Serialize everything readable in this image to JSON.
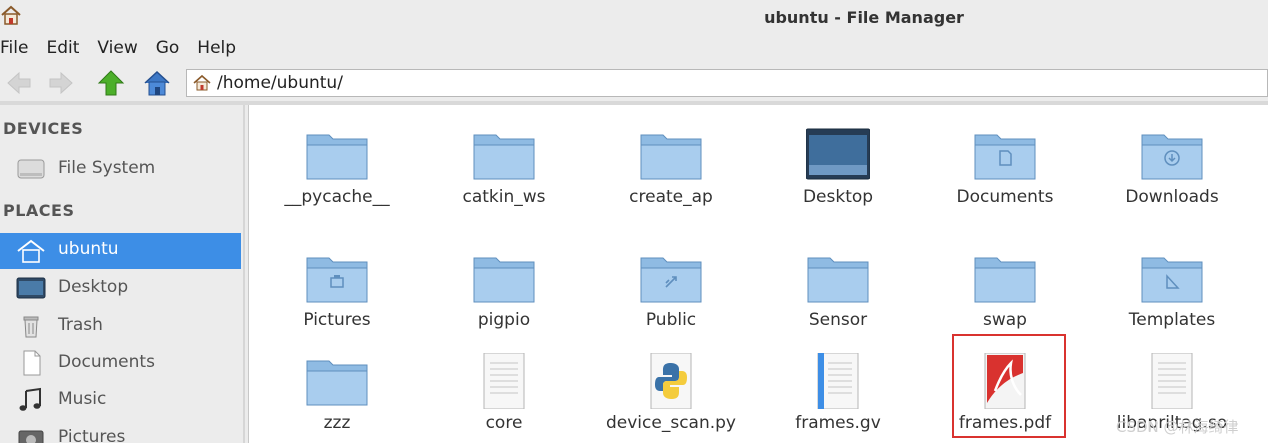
{
  "window": {
    "title": "ubuntu - File Manager"
  },
  "menu": [
    "File",
    "Edit",
    "View",
    "Go",
    "Help"
  ],
  "address": {
    "path": "/home/ubuntu/"
  },
  "sidebar": {
    "devices_header": "DEVICES",
    "devices": [
      {
        "label": "File System",
        "icon": "drive-icon"
      }
    ],
    "places_header": "PLACES",
    "places": [
      {
        "label": "ubuntu",
        "icon": "home-icon",
        "active": true
      },
      {
        "label": "Desktop",
        "icon": "desktop-icon"
      },
      {
        "label": "Trash",
        "icon": "trash-icon"
      },
      {
        "label": "Documents",
        "icon": "document-icon"
      },
      {
        "label": "Music",
        "icon": "music-icon"
      },
      {
        "label": "Pictures",
        "icon": "pictures-icon"
      }
    ]
  },
  "files": [
    {
      "name": "__pycache__",
      "type": "folder"
    },
    {
      "name": "catkin_ws",
      "type": "folder"
    },
    {
      "name": "create_ap",
      "type": "folder"
    },
    {
      "name": "Desktop",
      "type": "desktop-folder"
    },
    {
      "name": "Documents",
      "type": "documents-folder"
    },
    {
      "name": "Downloads",
      "type": "downloads-folder"
    },
    {
      "name": "Pictures",
      "type": "pictures-folder"
    },
    {
      "name": "pigpio",
      "type": "folder"
    },
    {
      "name": "Public",
      "type": "public-folder"
    },
    {
      "name": "Sensor",
      "type": "folder"
    },
    {
      "name": "swap",
      "type": "folder"
    },
    {
      "name": "Templates",
      "type": "templates-folder"
    },
    {
      "name": "zzz",
      "type": "folder"
    },
    {
      "name": "core",
      "type": "text-file"
    },
    {
      "name": "device_scan.py",
      "type": "python-file"
    },
    {
      "name": "frames.gv",
      "type": "text-file"
    },
    {
      "name": "frames.pdf",
      "type": "pdf-file",
      "highlighted": true
    },
    {
      "name": "libapriltag.so",
      "type": "text-file"
    }
  ],
  "watermark": "CSDN @林海绮律",
  "colors": {
    "selection": "#3d8ee6",
    "highlight_box": "#d9322f",
    "folder": "#8fbbe3"
  }
}
